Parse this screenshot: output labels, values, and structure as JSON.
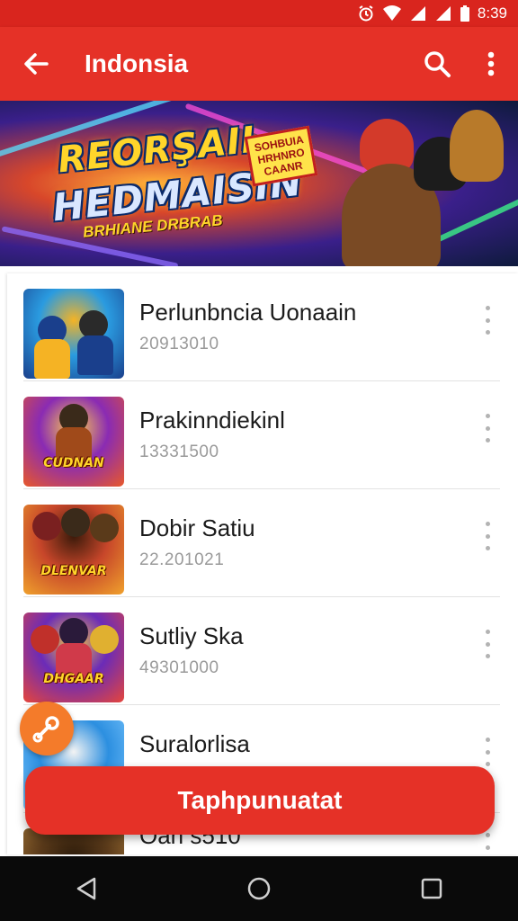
{
  "status_bar": {
    "time": "8:39",
    "icons": [
      "alarm-icon",
      "wifi-icon",
      "signal-icon",
      "signal-icon",
      "battery-icon"
    ]
  },
  "app_bar": {
    "title": "Indonsia",
    "icons": [
      "back-arrow-icon",
      "search-icon",
      "more-vertical-icon"
    ]
  },
  "banner": {
    "headline_1": "REORŞAII",
    "headline_2": "HEDMAISIN",
    "tagline": "BRHIANE DRBRAB",
    "badge_lines": [
      "SOHBUIA",
      "HRHNRO",
      "CAANR"
    ]
  },
  "games": [
    {
      "name": "Perlunbncia Uonaain",
      "count": "20913010",
      "thumb_label": "",
      "thumb_colors": [
        "#2a9be0",
        "#1a3f8c",
        "#f5b324"
      ]
    },
    {
      "name": "Prakinndiekinl",
      "count": "13331500",
      "thumb_label": "CUDNAN",
      "thumb_colors": [
        "#8a2bb3",
        "#e8582a",
        "#ffd04a"
      ]
    },
    {
      "name": "Dobir Satiu",
      "count": "22.201021",
      "thumb_label": "DLENVAR",
      "thumb_colors": [
        "#c7462a",
        "#f0a12c",
        "#3b1a0a"
      ]
    },
    {
      "name": "Sutliy Ska",
      "count": "49301000",
      "thumb_label": "DHGAAR",
      "thumb_colors": [
        "#6b2bb8",
        "#e6453a",
        "#f5c840"
      ]
    },
    {
      "name": "Suralorlisa",
      "count": "",
      "thumb_label": "",
      "thumb_colors": [
        "#2c8fe0",
        "#7fc9ff",
        "#f3f3f3"
      ]
    },
    {
      "name": "Oan s510",
      "count": "",
      "thumb_label": "",
      "thumb_colors": [
        "#5a3a1a",
        "#a87a3a",
        "#2a1a0a"
      ]
    }
  ],
  "fab": {
    "icon": "wrench-icon",
    "color": "#f47b2a"
  },
  "cta": {
    "label": "Taphpunuatat"
  },
  "nav_bar": {
    "icons": [
      "back-triangle-icon",
      "home-circle-icon",
      "recents-square-icon"
    ]
  },
  "colors": {
    "primary": "#e53127",
    "status": "#d9251e",
    "fab": "#f47b2a"
  }
}
